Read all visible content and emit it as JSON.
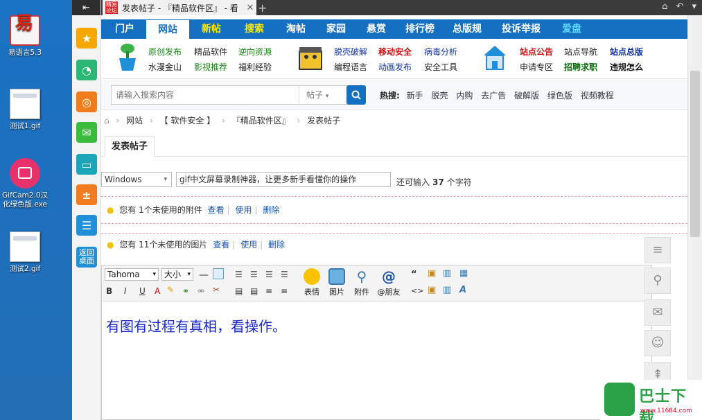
{
  "desktop": {
    "icons": [
      {
        "label": "易语言5.3",
        "icon": "yi-language-icon"
      },
      {
        "label": "测试1.gif",
        "icon": "gif-file-icon"
      },
      {
        "label": "GifCam2.0汉化绿色版.exe",
        "label_l1": "GifCam2.0汉",
        "label_l2": "化绿色版.exe",
        "icon": "camera-icon"
      },
      {
        "label": "测试2.gif",
        "icon": "gif-file-icon"
      }
    ]
  },
  "dock": {
    "back_icon": "back-icon",
    "home_label_1": "返回",
    "home_label_2": "桌面"
  },
  "browser": {
    "tab_title": "发表帖子 - 『精品软件区』 - 看",
    "tab_fav_text": "精易论坛"
  },
  "nav": {
    "items": [
      "门户",
      "网站",
      "新帖",
      "搜索",
      "淘帖",
      "家园",
      "悬赏",
      "排行榜",
      "总版规",
      "投诉举报",
      "爱盘"
    ],
    "active": "网站"
  },
  "subnav": {
    "group1": [
      "原创发布",
      "精品软件",
      "逆向资源",
      "水漫金山",
      "影视推荐",
      "福利经验"
    ],
    "group2": [
      "脱壳破解",
      "移动安全",
      "病毒分析",
      "编程语言",
      "动画发布",
      "安全工具"
    ],
    "group3": [
      "站点公告",
      "站点导航",
      "站点总版",
      "申请专区",
      "招聘求职",
      "违规怎么"
    ]
  },
  "search": {
    "placeholder": "请输入搜索内容",
    "type": "帖子",
    "hot_label": "热搜:",
    "hot_items": [
      "新手",
      "脱壳",
      "内购",
      "去广告",
      "破解版",
      "绿色版",
      "视频教程"
    ]
  },
  "breadcrumb": [
    "网站",
    "【 软件安全 】",
    "『精品软件区』",
    "发表帖子"
  ],
  "post_tab": "发表帖子",
  "form": {
    "os_select": "Windows",
    "title_value": "gif中文屏幕录制神器，让更多新手看懂你的操作",
    "count_prefix": "还可输入",
    "count": "37",
    "count_suffix": "个字符"
  },
  "attachments": {
    "row1": {
      "text": "您有  1个未使用的附件",
      "view": "查看",
      "use": "使用",
      "del": "删除"
    },
    "row2": {
      "text": "您有  11个未使用的图片",
      "view": "查看",
      "use": "使用",
      "del": "删除"
    }
  },
  "editor": {
    "font": "Tahoma",
    "size": "大小",
    "btn_emoji": "表情",
    "btn_image": "图片",
    "btn_attach": "附件",
    "btn_at": "@朋友",
    "content": "有图有过程有真相，看操作。"
  },
  "watermark": {
    "name": "巴士下载",
    "url": "www.11684.com"
  }
}
